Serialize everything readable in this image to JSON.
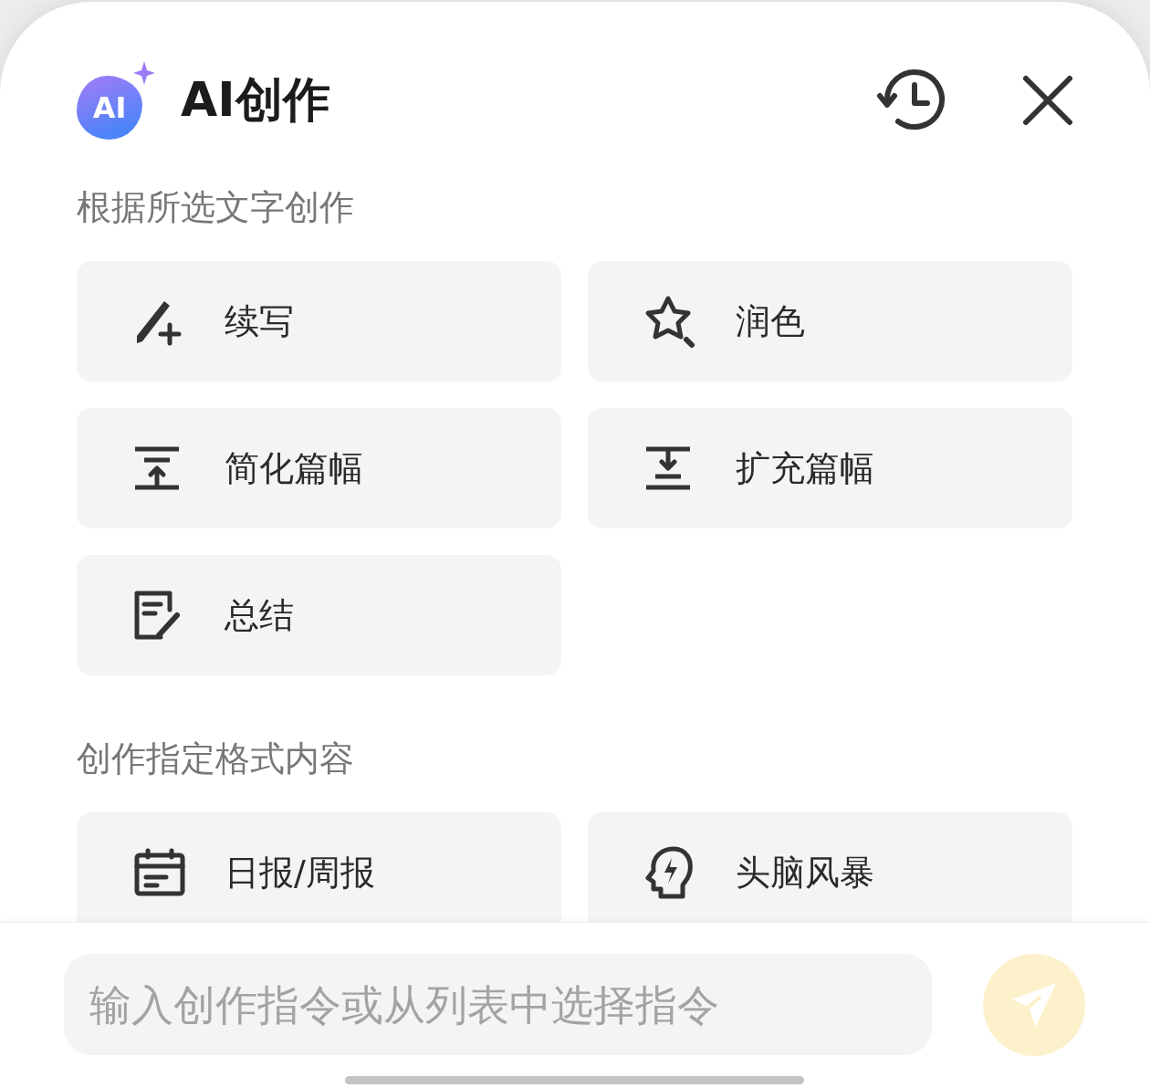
{
  "header": {
    "logo_text": "AI",
    "title": "AI创作"
  },
  "sections": [
    {
      "title": "根据所选文字创作",
      "items": [
        {
          "label": "续写",
          "kind": "continue"
        },
        {
          "label": "润色",
          "kind": "polish"
        },
        {
          "label": "简化篇幅",
          "kind": "shorten"
        },
        {
          "label": "扩充篇幅",
          "kind": "expand"
        },
        {
          "label": "总结",
          "kind": "summary"
        }
      ]
    },
    {
      "title": "创作指定格式内容",
      "items": [
        {
          "label": "日报/周报",
          "kind": "report"
        },
        {
          "label": "头脑风暴",
          "kind": "brainstorm"
        }
      ]
    }
  ],
  "input": {
    "placeholder": "输入创作指令或从列表中选择指令"
  },
  "send_button": {
    "disabled": true
  }
}
